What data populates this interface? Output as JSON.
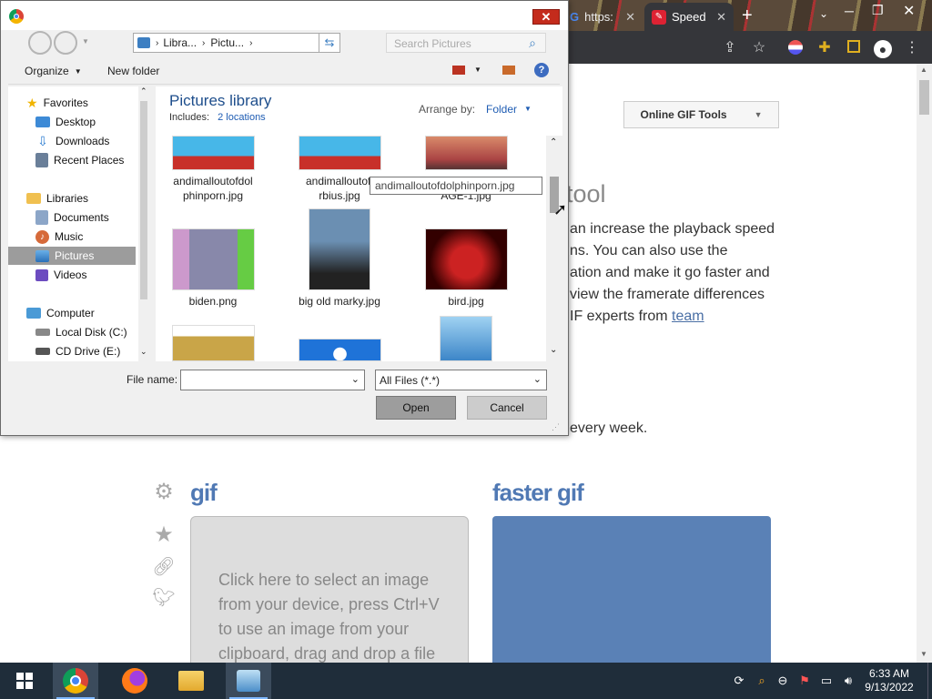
{
  "browser": {
    "tabs": [
      {
        "label": "https:",
        "active": false
      },
      {
        "label": "Speed",
        "active": true
      }
    ],
    "new_tab_label": "+",
    "page": {
      "dropdown_label": "Online GIF Tools",
      "title_fragment": "tool",
      "paragraph_lines": [
        "an increase the playback speed",
        "ns. You can also use the",
        "ation and make it go faster and",
        "view the framerate differences",
        "IF experts from"
      ],
      "team_link": "team",
      "every_week": "every week.",
      "input_heading": "gif",
      "output_heading": "faster gif",
      "dropzone_text": "Click here to select an image from your device, press Ctrl+V to use an image from your clipboard, drag and drop a file"
    }
  },
  "dialog": {
    "address_parts": [
      "Libra...",
      "Pictu..."
    ],
    "search_placeholder": "Search Pictures",
    "organize_label": "Organize",
    "new_folder_label": "New folder",
    "nav": {
      "favorites_label": "Favorites",
      "favorites": [
        "Desktop",
        "Downloads",
        "Recent Places"
      ],
      "libraries_label": "Libraries",
      "libraries": [
        "Documents",
        "Music",
        "Pictures",
        "Videos"
      ],
      "selected": "Pictures",
      "computer_label": "Computer",
      "computer": [
        "Local Disk (C:)",
        "CD Drive (E:)"
      ]
    },
    "library_title": "Pictures library",
    "includes_label": "Includes:",
    "includes_link": "2 locations",
    "arrange_label": "Arrange by:",
    "arrange_value": "Folder",
    "files": [
      {
        "name_l1": "andimalloutofdol",
        "name_l2": "phinporn.jpg"
      },
      {
        "name_l1": "andimalloutofi",
        "name_l2": "rbius.jpg"
      },
      {
        "name_l1": "AGE-1.jpg",
        "name_l2": ""
      },
      {
        "name_l1": "biden.png",
        "name_l2": ""
      },
      {
        "name_l1": "big old marky.jpg",
        "name_l2": ""
      },
      {
        "name_l1": "bird.jpg",
        "name_l2": ""
      }
    ],
    "tooltip": "andimalloutofdolphinporn.jpg",
    "file_name_label": "File name:",
    "file_name_value": "",
    "file_type": "All Files (*.*)",
    "open_label": "Open",
    "cancel_label": "Cancel"
  },
  "taskbar": {
    "time": "6:33 AM",
    "date": "9/13/2022"
  },
  "colors": {
    "accent_blue": "#5079b4",
    "dialog_bg": "#f0f0f0",
    "taskbar": "#1f2d3a"
  }
}
